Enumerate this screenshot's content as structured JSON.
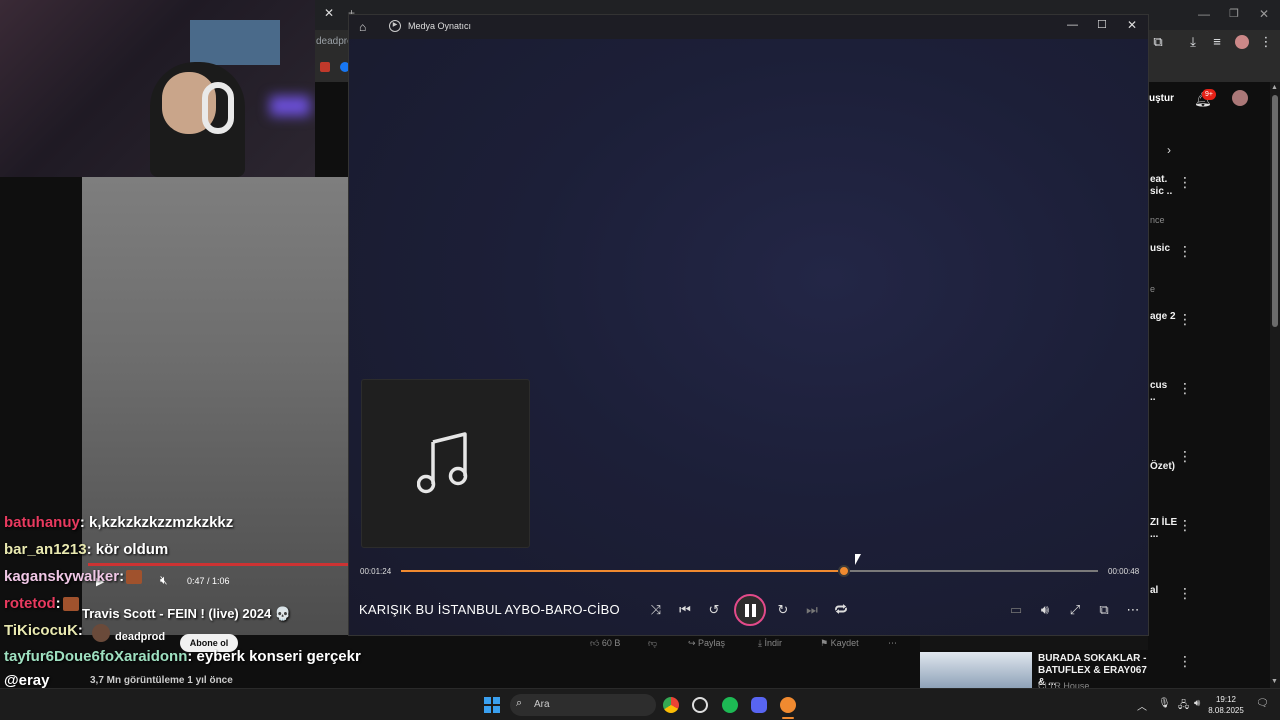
{
  "browser": {
    "tab_fragment": "deadpro",
    "right_column": {
      "create_button": "uştur",
      "notification_count": "9+",
      "items": [
        {
          "line1": "eat.",
          "line2": "sic ..",
          "line3": "nce"
        },
        {
          "line1": "usic",
          "line2": "",
          "line3": "e"
        },
        {
          "line1": "age 2",
          "line2": "",
          "line3": ""
        },
        {
          "line1": "cus",
          "line2": "..",
          "line3": ""
        },
        {
          "line1": "Özet)",
          "line2": "",
          "line3": ""
        },
        {
          "line1": "ZI İLE",
          "line2": "...",
          "line3": ""
        },
        {
          "line1": "al",
          "line2": "",
          "line3": ""
        }
      ],
      "bottom_rec": {
        "title": "BURADA SOKAKLAR - BATUFLEX & ERAY067 & ...",
        "channel": "CLTR House"
      }
    }
  },
  "embedded_video": {
    "time": "0:47 / 1:06",
    "title": "Travis Scott - FEIN ! (live) 2024 💀",
    "channel": "deadprod",
    "subscribe_label": "Abone ol",
    "views": "3,7 Mn görüntüleme  1 yıl önce",
    "likes": "60 B",
    "share": "Paylaş",
    "download": "İndir",
    "save": "Kaydet"
  },
  "chat": [
    {
      "user": "batuhanuy",
      "message": ": k,kzkzkzkzzmzkzkkz"
    },
    {
      "user": "bar_an1213",
      "message": ": kör oldum"
    },
    {
      "user": "kaganskywalker",
      "message": ":"
    },
    {
      "user": "rotetod",
      "message": ":"
    },
    {
      "user": "TiKicocuK",
      "message": ":"
    },
    {
      "user": "tayfur6Doue6foXaraidonn",
      "message": ": eyberk konseri gerçekr"
    },
    {
      "user": "@eray",
      "message": ""
    }
  ],
  "player": {
    "app_title": "Medya Oynatıcı",
    "track_title": "KARIŞIK BU İSTANBUL AYBO-BARO-CİBO",
    "current_time": "00:01:24",
    "remaining_time": "00:00:48",
    "progress": 0.636,
    "accent": "#f08a30"
  },
  "taskbar": {
    "search_placeholder": "Ara",
    "time": "19:12",
    "date": "8.08.2025"
  }
}
